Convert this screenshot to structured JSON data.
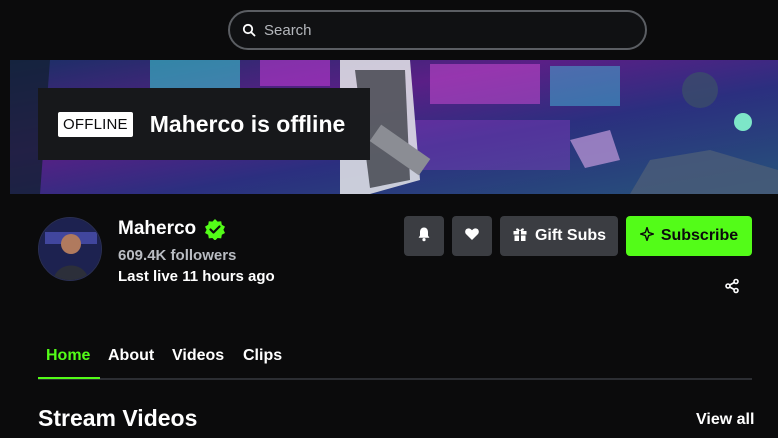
{
  "search": {
    "placeholder": "Search"
  },
  "banner": {
    "offline_badge": "OFFLINE",
    "offline_message": "Maherco is offline"
  },
  "channel": {
    "name": "Maherco",
    "followers": "609.4K followers",
    "last_live": "Last live 11 hours ago"
  },
  "actions": {
    "notify_icon": "bell-icon",
    "follow_icon": "heart-icon",
    "gift_label": "Gift Subs",
    "subscribe_label": "Subscribe",
    "share_icon": "share-icon"
  },
  "tabs": [
    {
      "label": "Home",
      "active": true
    },
    {
      "label": "About",
      "active": false
    },
    {
      "label": "Videos",
      "active": false
    },
    {
      "label": "Clips",
      "active": false
    }
  ],
  "section": {
    "title": "Stream Videos",
    "view_all": "View all"
  },
  "colors": {
    "accent": "#53fc18",
    "background": "#0b0b0c",
    "button": "#3b3d42"
  }
}
